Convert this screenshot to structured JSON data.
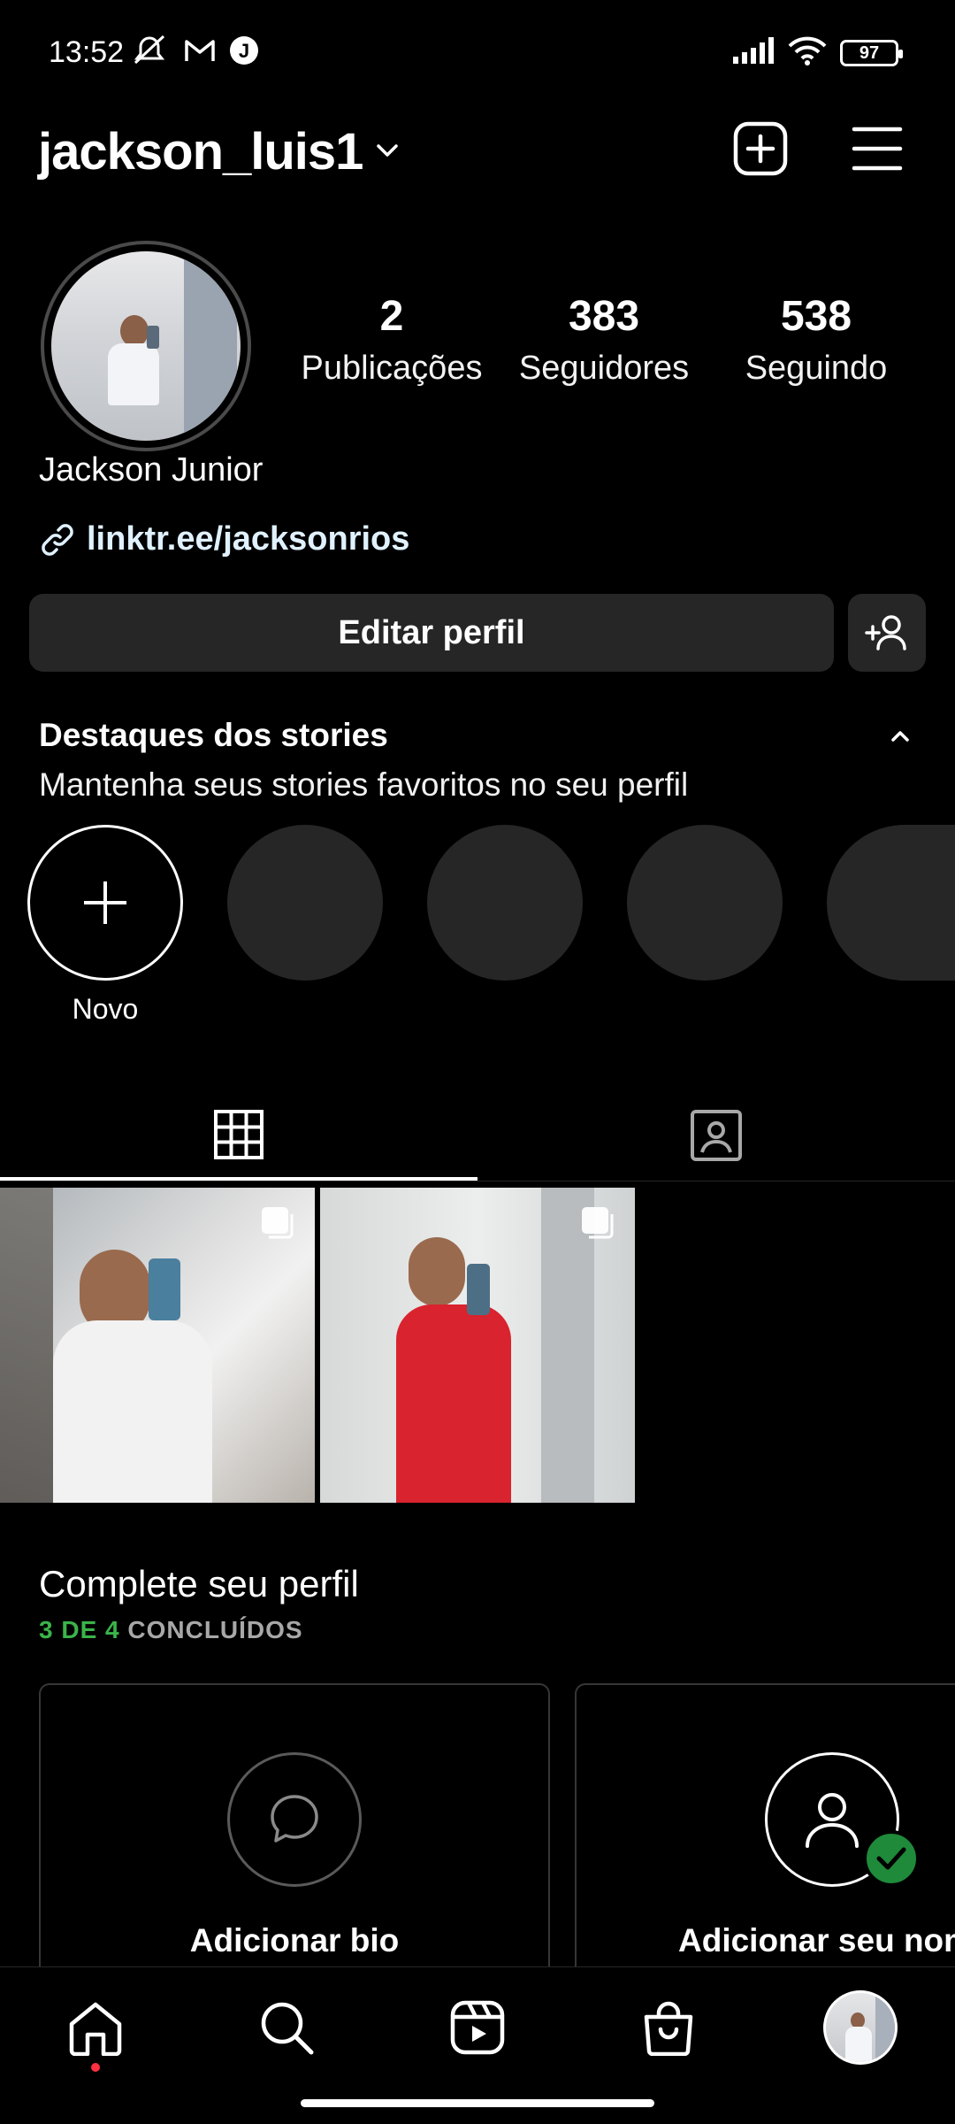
{
  "status_bar": {
    "time": "13:52",
    "battery": "97"
  },
  "header": {
    "username": "jackson_luis1"
  },
  "profile": {
    "stats": [
      {
        "value": "2",
        "label": "Publicações"
      },
      {
        "value": "383",
        "label": "Seguidores"
      },
      {
        "value": "538",
        "label": "Seguindo"
      }
    ],
    "full_name": "Jackson Junior",
    "link": "linktr.ee/jacksonrios",
    "edit_button": "Editar perfil"
  },
  "highlights": {
    "title": "Destaques dos stories",
    "subtitle": "Mantenha seus stories favoritos no seu perfil",
    "new_label": "Novo"
  },
  "complete_profile": {
    "title": "Complete seu perfil",
    "progress_done": "3 DE 4",
    "progress_suffix": " CONCLUÍDOS",
    "cards": [
      {
        "label": "Adicionar bio",
        "icon": "speech-bubble-icon"
      },
      {
        "label": "Adicionar seu nome",
        "icon": "person-icon",
        "completed": true
      }
    ]
  },
  "bottom_nav": {
    "items": [
      "home-icon",
      "search-icon",
      "reels-icon",
      "shop-icon",
      "profile-avatar"
    ]
  },
  "colors": {
    "accent_green": "#3bb44a",
    "notification_red": "#ff3040",
    "surface": "#262626"
  }
}
